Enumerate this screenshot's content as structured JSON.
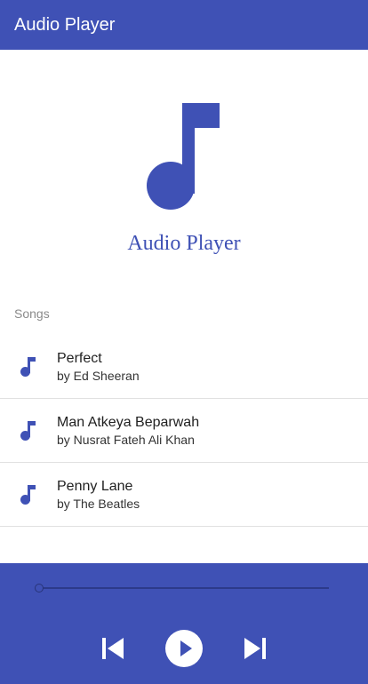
{
  "appbar": {
    "title": "Audio Player"
  },
  "hero": {
    "title": "Audio Player",
    "icon": "music-note-icon"
  },
  "songs_section": {
    "label": "Songs"
  },
  "songs": [
    {
      "title": "Perfect",
      "artist": "by Ed Sheeran",
      "icon": "music-note-icon"
    },
    {
      "title": "Man Atkeya Beparwah",
      "artist": "by Nusrat Fateh Ali Khan",
      "icon": "music-note-icon"
    },
    {
      "title": "Penny Lane",
      "artist": "by The Beatles",
      "icon": "music-note-icon"
    }
  ],
  "player": {
    "progress": 0,
    "controls": [
      "skip-previous-icon",
      "play-icon",
      "skip-next-icon"
    ]
  },
  "colors": {
    "primary": "#3f51b5",
    "background": "#ffffff",
    "divider": "#e0e0e0",
    "secondary_text": "#8a8a8a"
  }
}
